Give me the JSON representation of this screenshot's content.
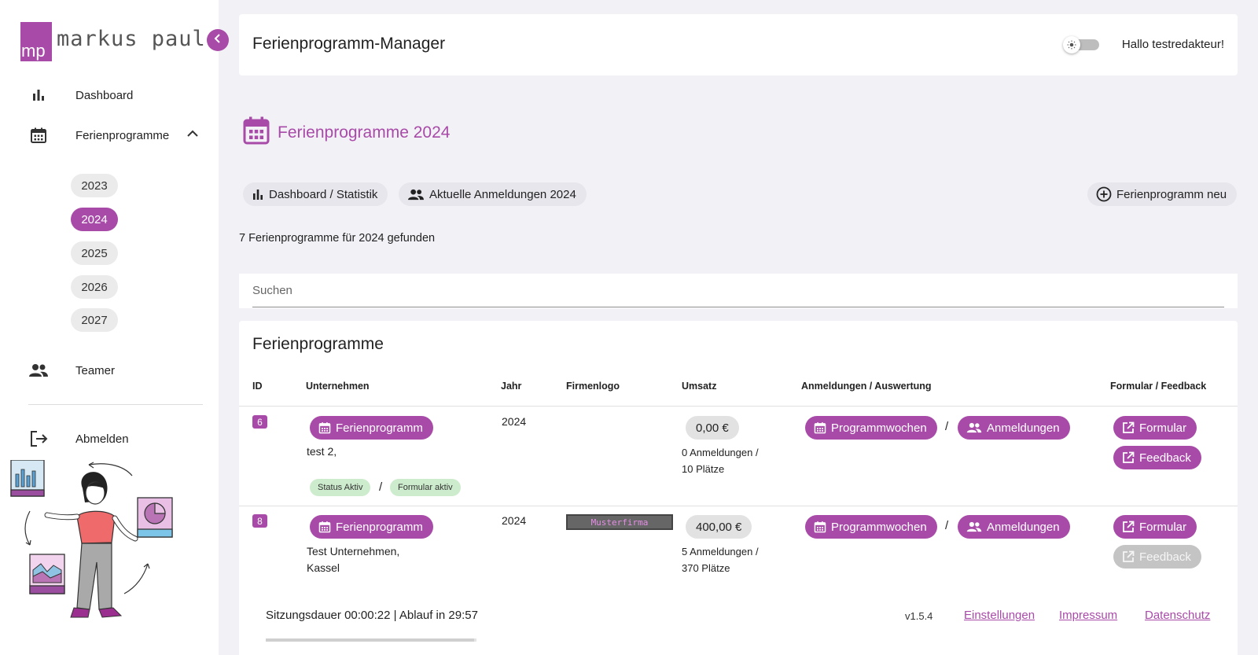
{
  "brand": {
    "logo_mark": "mp",
    "logo_text": "markus paul"
  },
  "sidebar": {
    "items": [
      {
        "label": "Dashboard",
        "icon": "bar-chart-icon"
      },
      {
        "label": "Ferienprogramme",
        "icon": "calendar-icon",
        "expanded": true
      },
      {
        "label": "Teamer",
        "icon": "people-icon"
      },
      {
        "label": "Abmelden",
        "icon": "logout-icon"
      }
    ],
    "years": [
      "2023",
      "2024",
      "2025",
      "2026",
      "2027"
    ],
    "active_year": "2024"
  },
  "header": {
    "title": "Ferienprogramm-Manager",
    "greeting": "Hallo testredakteur!"
  },
  "page": {
    "heading": "Ferienprogramme 2024",
    "chips": {
      "dashboard": "Dashboard / Statistik",
      "anmeldungen": "Aktuelle Anmeldungen 2024",
      "new": "Ferienprogramm neu"
    },
    "found_text": "7 Ferienprogramme für 2024 gefunden",
    "search_placeholder": "Suchen"
  },
  "table": {
    "title": "Ferienprogramme",
    "columns": [
      "ID",
      "Unternehmen",
      "Jahr",
      "Firmenlogo",
      "Umsatz",
      "Anmeldungen / Auswertung",
      "Formular / Feedback"
    ],
    "buttons": {
      "ferienprogramm": "Ferienprogramm",
      "programmwochen": "Programmwochen",
      "anmeldungen": "Anmeldungen",
      "formular": "Formular",
      "feedback": "Feedback"
    },
    "separator": "/",
    "rows": [
      {
        "id": "6",
        "company_line1": "test 2,",
        "company_line2": "",
        "year": "2024",
        "logo": "",
        "umsatz": "0,00 €",
        "anmeldungen_line": "0 Anmeldungen /",
        "plaetze_line": "10 Plätze",
        "status": "Status Aktiv",
        "formular_status": "Formular aktiv",
        "feedback_enabled": true
      },
      {
        "id": "8",
        "company_line1": "Test Unternehmen,",
        "company_line2": "Kassel",
        "year": "2024",
        "logo": "Musterfirma",
        "umsatz": "400,00 €",
        "anmeldungen_line": "5 Anmeldungen /",
        "plaetze_line": "370 Plätze",
        "feedback_enabled": false
      }
    ]
  },
  "footer": {
    "session": "Sitzungsdauer 00:00:22 | Ablauf in 29:57",
    "session_progress": 0.99,
    "version": "v1.5.4",
    "links": [
      "Einstellungen",
      "Impressum",
      "Datenschutz"
    ]
  },
  "colors": {
    "accent": "#a84aa8",
    "background": "#f2f1f6",
    "status_green": "#cdeccd"
  }
}
